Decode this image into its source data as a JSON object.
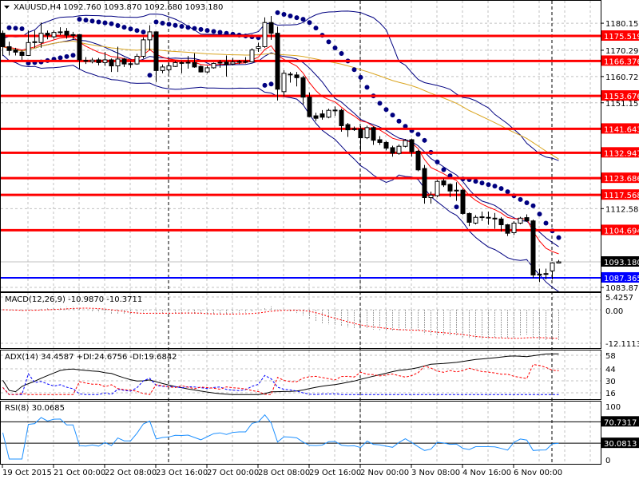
{
  "header": {
    "symbol": "XAUUSD,H4",
    "ohlc_text": "1092.760 1093.870 1092.680 1093.180"
  },
  "indicators": {
    "macd": "MACD(12,26,9) -10.9870 -10.3711",
    "adx": "ADX(14) 34.4587 +DI:24.6756 -DI:19.6842",
    "rsi": "RSI(8) 30.0685"
  },
  "colors": {
    "bull": "#ffffff",
    "bear": "#000000",
    "level": "#ff0000",
    "support": "#0000ff",
    "bands": "#000080",
    "ema": "#ff0000",
    "sma": "#daa520",
    "sar": "#000080",
    "grid": "#c0c0c0"
  },
  "chart_data": {
    "type": "candlestick",
    "title": "XAUUSD,H4",
    "ylim": [
      1083.87,
      1184.5
    ],
    "y_ticks": [
      "1180.150",
      "1170.290",
      "1160.720",
      "1151.150",
      "1112.580",
      "1083.870"
    ],
    "x_ticks": [
      "19 Oct 2015",
      "21 Oct 00:00",
      "22 Oct 08:00",
      "23 Oct 16:00",
      "27 Oct 00:00",
      "28 Oct 08:00",
      "29 Oct 16:00",
      "2 Nov 00:00",
      "3 Nov 08:00",
      "4 Nov 16:00",
      "6 Nov 00:00"
    ],
    "candles_per_tick": 8,
    "ohlc": [
      [
        1176.5,
        1177.5,
        1168.2,
        1171.6
      ],
      [
        1171.6,
        1173.4,
        1168.4,
        1170.2
      ],
      [
        1170.4,
        1171.2,
        1168.4,
        1169.6
      ],
      [
        1169.6,
        1170.4,
        1166.8,
        1168.4
      ],
      [
        1168.4,
        1177.5,
        1168.2,
        1173.1
      ],
      [
        1173.1,
        1177.5,
        1171.2,
        1173.4
      ],
      [
        1173.1,
        1180.4,
        1171.2,
        1176.5
      ],
      [
        1176.5,
        1177.5,
        1174.3,
        1175.8
      ],
      [
        1175.2,
        1177.5,
        1174.5,
        1176.8
      ],
      [
        1177.0,
        1178.7,
        1175.8,
        1176.9
      ],
      [
        1177.2,
        1178.4,
        1174.5,
        1175.8
      ],
      [
        1176.0,
        1177.0,
        1174.1,
        1175.8
      ],
      [
        1176.0,
        1176.2,
        1163.4,
        1166.8
      ],
      [
        1166.6,
        1167.8,
        1165.3,
        1166.4
      ],
      [
        1166.1,
        1167.5,
        1165.5,
        1166.7
      ],
      [
        1166.8,
        1167.5,
        1164.8,
        1165.8
      ],
      [
        1165.8,
        1169.7,
        1164.6,
        1166.8
      ],
      [
        1166.8,
        1167.3,
        1162.4,
        1164.6
      ],
      [
        1164.6,
        1171.6,
        1162.4,
        1167.1
      ],
      [
        1167.1,
        1167.5,
        1164.2,
        1165.3
      ],
      [
        1165.4,
        1166.3,
        1163.9,
        1165.3
      ],
      [
        1165.3,
        1169.0,
        1165.0,
        1168.1
      ],
      [
        1168.1,
        1175.0,
        1167.3,
        1174.1
      ],
      [
        1174.1,
        1179.4,
        1170.2,
        1177.0
      ],
      [
        1177.0,
        1177.2,
        1158.7,
        1162.9
      ],
      [
        1162.9,
        1165.1,
        1161.9,
        1164.2
      ],
      [
        1163.2,
        1165.8,
        1161.9,
        1164.6
      ],
      [
        1164.4,
        1166.3,
        1164.2,
        1165.8
      ],
      [
        1165.8,
        1166.3,
        1161.9,
        1165.7
      ],
      [
        1165.8,
        1168.2,
        1163.6,
        1165.9
      ],
      [
        1165.8,
        1169.2,
        1163.9,
        1164.2
      ],
      [
        1164.4,
        1164.8,
        1162.2,
        1162.4
      ],
      [
        1162.4,
        1164.6,
        1161.9,
        1163.9
      ],
      [
        1163.9,
        1165.8,
        1163.6,
        1165.5
      ],
      [
        1165.7,
        1166.8,
        1163.9,
        1165.9
      ],
      [
        1166.0,
        1168.4,
        1160.7,
        1165.1
      ],
      [
        1165.3,
        1167.5,
        1164.8,
        1166.0
      ],
      [
        1166.1,
        1166.8,
        1165.3,
        1166.2
      ],
      [
        1166.1,
        1167.8,
        1165.5,
        1166.2
      ],
      [
        1166.1,
        1171.0,
        1165.8,
        1170.4
      ],
      [
        1171.0,
        1173.1,
        1169.7,
        1171.6
      ],
      [
        1171.6,
        1182.3,
        1171.2,
        1180.4
      ],
      [
        1180.4,
        1182.8,
        1174.1,
        1176.5
      ],
      [
        1176.5,
        1178.9,
        1152.0,
        1156.1
      ],
      [
        1155.2,
        1163.0,
        1153.5,
        1161.9
      ],
      [
        1161.6,
        1162.4,
        1158.5,
        1161.4
      ],
      [
        1161.3,
        1162.4,
        1157.1,
        1160.3
      ],
      [
        1160.3,
        1161.0,
        1150.3,
        1153.2
      ],
      [
        1153.2,
        1154.9,
        1145.9,
        1146.1
      ],
      [
        1146.4,
        1147.5,
        1144.5,
        1145.5
      ],
      [
        1147.1,
        1148.5,
        1145.0,
        1145.9
      ],
      [
        1145.9,
        1149.0,
        1145.5,
        1148.4
      ],
      [
        1148.4,
        1149.8,
        1146.4,
        1148.5
      ],
      [
        1148.4,
        1149.0,
        1140.6,
        1142.8
      ],
      [
        1143.2,
        1143.8,
        1138.7,
        1141.3
      ],
      [
        1141.7,
        1142.5,
        1140.9,
        1141.4
      ],
      [
        1141.6,
        1142.6,
        1133.3,
        1138.4
      ],
      [
        1138.4,
        1142.8,
        1137.9,
        1142.1
      ],
      [
        1142.1,
        1142.5,
        1135.8,
        1137.5
      ],
      [
        1137.7,
        1139.0,
        1135.8,
        1136.7
      ],
      [
        1136.7,
        1137.2,
        1133.8,
        1134.6
      ],
      [
        1134.8,
        1135.5,
        1131.5,
        1132.8
      ],
      [
        1132.7,
        1136.0,
        1132.2,
        1135.3
      ],
      [
        1135.3,
        1138.0,
        1134.9,
        1137.4
      ],
      [
        1137.7,
        1138.1,
        1131.5,
        1133.3
      ],
      [
        1133.5,
        1134.0,
        1126.2,
        1126.7
      ],
      [
        1127.2,
        1128.5,
        1114.4,
        1116.6
      ],
      [
        1116.6,
        1118.8,
        1114.4,
        1117.5
      ],
      [
        1117.3,
        1123.0,
        1116.8,
        1122.5
      ],
      [
        1122.7,
        1123.5,
        1120.5,
        1121.2
      ],
      [
        1121.4,
        1121.8,
        1116.8,
        1119.0
      ],
      [
        1119.3,
        1122.2,
        1115.4,
        1119.2
      ],
      [
        1119.3,
        1119.8,
        1110.3,
        1110.8
      ],
      [
        1110.8,
        1111.2,
        1106.2,
        1107.6
      ],
      [
        1107.3,
        1110.2,
        1106.8,
        1109.4
      ],
      [
        1109.6,
        1111.5,
        1108.1,
        1109.4
      ],
      [
        1109.4,
        1111.5,
        1106.7,
        1109.3
      ],
      [
        1109.1,
        1111.0,
        1105.2,
        1109.0
      ],
      [
        1108.8,
        1109.5,
        1104.2,
        1106.7
      ],
      [
        1106.7,
        1107.0,
        1102.6,
        1103.6
      ],
      [
        1103.8,
        1108.0,
        1103.0,
        1107.3
      ],
      [
        1107.3,
        1109.6,
        1106.9,
        1109.1
      ],
      [
        1109.3,
        1110.5,
        1107.8,
        1108.1
      ],
      [
        1108.1,
        1108.6,
        1087.3,
        1088.4
      ],
      [
        1088.6,
        1090.7,
        1085.8,
        1088.7
      ],
      [
        1088.9,
        1090.7,
        1086.8,
        1088.8
      ],
      [
        1089.9,
        1093.0,
        1086.8,
        1092.8
      ],
      [
        1092.76,
        1093.87,
        1092.68,
        1093.18
      ]
    ],
    "resistance_levels": [
      "1175.519",
      "1166.376",
      "1153.676",
      "1141.643",
      "1132.947",
      "1123.686",
      "1117.568",
      "1104.694"
    ],
    "support_level": "1087.365",
    "current_price": "1093.180",
    "week_separators": [
      26,
      56,
      86
    ],
    "macd_panel": {
      "ticks": [
        "5.4257",
        "0.00",
        "-12.1113"
      ],
      "range": [
        -12.1113,
        5.4257
      ]
    },
    "adx_panel": {
      "ticks": [
        "58",
        "44",
        "30",
        "16"
      ],
      "range": [
        14,
        62
      ]
    },
    "rsi_panel": {
      "ticks": [
        "100",
        "0"
      ],
      "levels": [
        "70.7317",
        "30.0813"
      ],
      "range": [
        0,
        100
      ]
    }
  }
}
